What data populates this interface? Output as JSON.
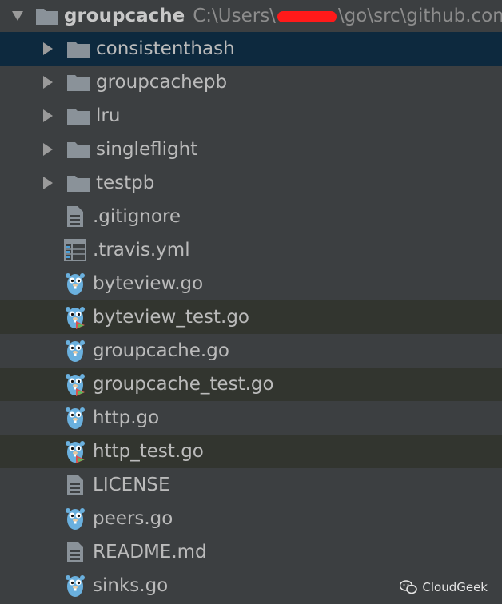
{
  "root": {
    "label": "groupcache",
    "path_prefix": "C:\\Users\\",
    "path_suffix": "\\go\\src\\github.com"
  },
  "folders": [
    {
      "label": "consistenthash",
      "selected": true
    },
    {
      "label": "groupcachepb"
    },
    {
      "label": "lru"
    },
    {
      "label": "singleflight"
    },
    {
      "label": "testpb"
    }
  ],
  "files": [
    {
      "label": ".gitignore",
      "type": "text-file-icon"
    },
    {
      "label": ".travis.yml",
      "type": "yaml-file-icon"
    },
    {
      "label": "byteview.go",
      "type": "go-file-icon"
    },
    {
      "label": "byteview_test.go",
      "type": "go-test-file-icon"
    },
    {
      "label": "groupcache.go",
      "type": "go-file-icon"
    },
    {
      "label": "groupcache_test.go",
      "type": "go-test-file-icon"
    },
    {
      "label": "http.go",
      "type": "go-file-icon"
    },
    {
      "label": "http_test.go",
      "type": "go-test-file-icon"
    },
    {
      "label": "LICENSE",
      "type": "text-file-icon"
    },
    {
      "label": "peers.go",
      "type": "go-file-icon"
    },
    {
      "label": "README.md",
      "type": "text-file-icon"
    },
    {
      "label": "sinks.go",
      "type": "go-file-icon"
    }
  ],
  "watermark": {
    "label": "CloudGeek"
  },
  "colors": {
    "background": "#3c3f41",
    "selected_row": "#0d293e",
    "test_row": "#32352f",
    "redaction": "#ff1a1a"
  }
}
